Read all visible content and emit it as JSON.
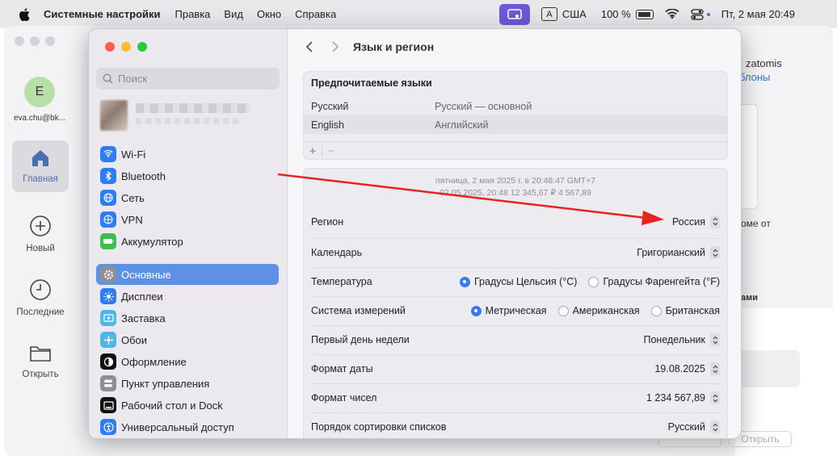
{
  "menubar": {
    "app_name": "Системные настройки",
    "menus": [
      "Правка",
      "Вид",
      "Окно",
      "Справка"
    ],
    "input_source_letter": "A",
    "input_source": "США",
    "battery": "100 %",
    "datetime": "Пт, 2 мая  20:49"
  },
  "background_app": {
    "avatar_letter": "E",
    "email": "eva.chu@bk...",
    "nav": [
      {
        "label": "Главная",
        "icon": "home-icon"
      },
      {
        "label": "Новый",
        "icon": "plus-circle-icon"
      },
      {
        "label": "Последние",
        "icon": "clock-icon"
      },
      {
        "label": "Открыть",
        "icon": "folder-icon"
      }
    ],
    "right_title": "zatomis",
    "right_link": "блоны",
    "right_text": "оме от",
    "right_text2": "ами",
    "open_button": "Открыть"
  },
  "settings": {
    "search_placeholder": "Поиск",
    "sidebar": [
      {
        "label": "Wi-Fi",
        "color": "#2f7cf6",
        "icon": "wifi-icon"
      },
      {
        "label": "Bluetooth",
        "color": "#2f7cf6",
        "icon": "bluetooth-icon"
      },
      {
        "label": "Сеть",
        "color": "#2f7cf6",
        "icon": "globe-icon"
      },
      {
        "label": "VPN",
        "color": "#2f7cf6",
        "icon": "vpn-icon"
      },
      {
        "label": "Аккумулятор",
        "color": "#3dbe4e",
        "icon": "battery-icon"
      },
      {
        "label": "Основные",
        "color": "#8e8e93",
        "icon": "gear-icon",
        "selected": true
      },
      {
        "label": "Дисплеи",
        "color": "#2f7cf6",
        "icon": "sun-icon"
      },
      {
        "label": "Заставка",
        "color": "#4fb6e8",
        "icon": "screensaver-icon"
      },
      {
        "label": "Обои",
        "color": "#4fb6e8",
        "icon": "wallpaper-icon"
      },
      {
        "label": "Оформление",
        "color": "#111111",
        "icon": "appearance-icon"
      },
      {
        "label": "Пункт управления",
        "color": "#8e8e93",
        "icon": "control-center-icon"
      },
      {
        "label": "Рабочий стол и Dock",
        "color": "#111111",
        "icon": "dock-icon"
      },
      {
        "label": "Универсальный доступ",
        "color": "#2f7cf6",
        "icon": "accessibility-icon"
      }
    ],
    "page_title": "Язык и регион",
    "languages": {
      "header": "Предпочитаемые языки",
      "rows": [
        {
          "name": "Русский",
          "desc": "Русский — основной"
        },
        {
          "name": "English",
          "desc": "Английский"
        }
      ],
      "add": "+",
      "remove": "−"
    },
    "preview": {
      "line1": "пятница, 2 мая 2025 г. в 20:48:47 GMT+7",
      "line2": "02.05.2025, 20:48     12 345,67 ₽     4 567,89"
    },
    "region": {
      "label": "Регион",
      "value": "Россия"
    },
    "calendar": {
      "label": "Календарь",
      "value": "Григорианский"
    },
    "temperature": {
      "label": "Температура",
      "options": [
        "Градусы Цельсия (°C)",
        "Градусы Фаренгейта (°F)"
      ],
      "selected": 0
    },
    "measurement": {
      "label": "Система измерений",
      "options": [
        "Метрическая",
        "Американская",
        "Британская"
      ],
      "selected": 0
    },
    "first_day": {
      "label": "Первый день недели",
      "value": "Понедельник"
    },
    "date_format": {
      "label": "Формат даты",
      "value": "19.08.2025"
    },
    "number_format": {
      "label": "Формат чисел",
      "value": "1 234 567,89"
    },
    "sort_order": {
      "label": "Порядок сортировки списков",
      "value": "Русский"
    }
  },
  "annotation_color": "#e8231f"
}
